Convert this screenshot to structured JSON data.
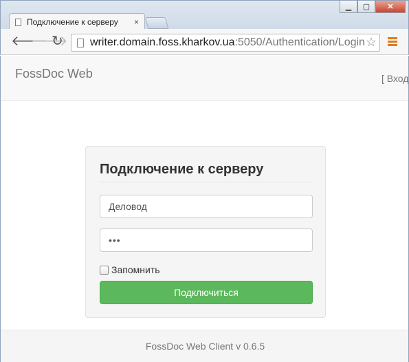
{
  "browser": {
    "tab_title": "Подключение к серверу",
    "tab_close": "×",
    "url_host": "writer.domain.foss.kharkov.ua",
    "url_rest": ":5050/Authentication/Login",
    "back_icon": "🡐",
    "forward_icon": "🡒",
    "reload_icon": "↻",
    "star_icon": "☆",
    "minimize": "▁",
    "maximize": "▢",
    "close": "✕"
  },
  "navbar": {
    "brand": "FossDoc Web",
    "login_link": "[ Вход ]"
  },
  "login": {
    "title": "Подключение к серверу",
    "username_value": "Деловод",
    "password_value": "•••",
    "remember_label": "Запомнить",
    "submit_label": "Подключиться"
  },
  "footer": {
    "text": "FossDoc Web Client v 0.6.5"
  },
  "colors": {
    "accent_green": "#5cb85c",
    "menu_orange": "#e07c1c"
  }
}
